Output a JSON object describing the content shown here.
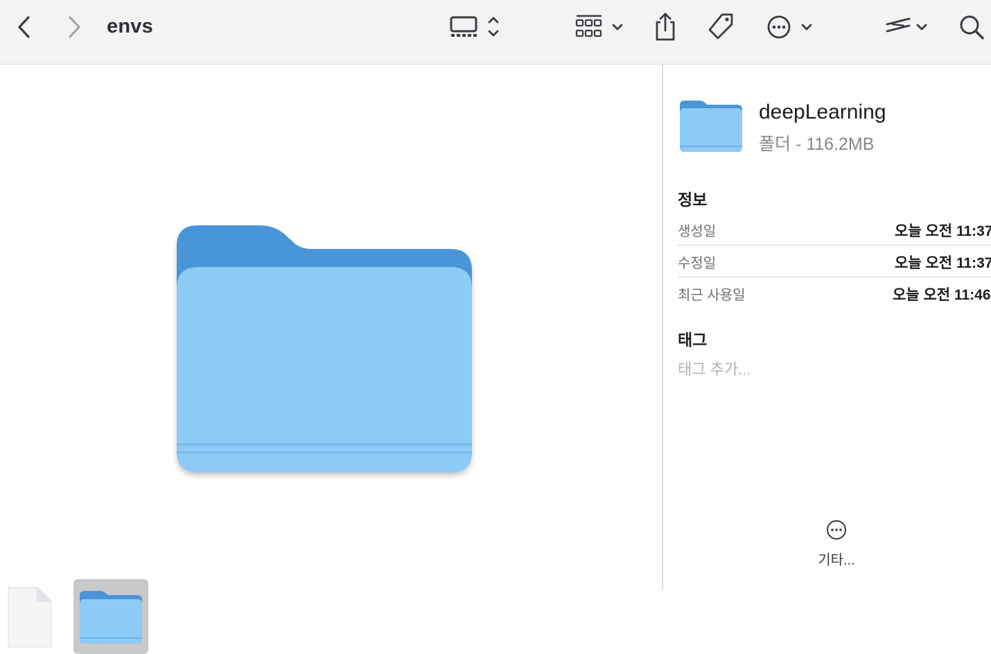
{
  "window": {
    "title": "envs"
  },
  "toolbar": {
    "icons": [
      "chevron-left-icon",
      "chevron-right-icon",
      "gallery-view-icon",
      "grid-group-icon",
      "share-icon",
      "tag-icon",
      "more-icon",
      "edit-markup-icon",
      "search-icon"
    ]
  },
  "inspector": {
    "name": "deepLearning",
    "kind": "폴더 - 116.2MB",
    "info_title": "정보",
    "rows": [
      {
        "label": "생성일",
        "value": "오늘 오전 11:37"
      },
      {
        "label": "수정일",
        "value": "오늘 오전 11:37"
      },
      {
        "label": "최근 사용일",
        "value": "오늘 오전 11:46"
      }
    ],
    "tags_title": "태그",
    "tags_placeholder": "태그 추가...",
    "more_label": "기타..."
  },
  "colors": {
    "folder_light": "#8ccbf6",
    "folder_dark": "#4a95d9",
    "toolbar_bg": "#f3f3f6"
  }
}
